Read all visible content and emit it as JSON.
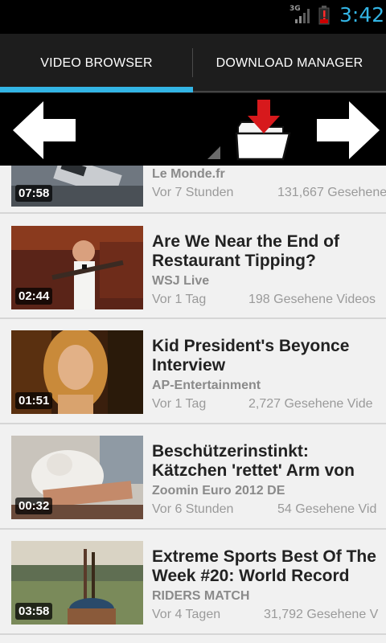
{
  "status_bar": {
    "network": "3G",
    "time": "3:42"
  },
  "tabs": [
    {
      "label": "VIDEO BROWSER",
      "selected": true
    },
    {
      "label": "DOWNLOAD MANAGER",
      "selected": false
    }
  ],
  "toolbar": {
    "back_icon": "arrow-left-icon",
    "download_icon": "download-folder-icon",
    "forward_icon": "arrow-right-icon"
  },
  "videos": [
    {
      "title_lines": [],
      "channel": "Le Monde.fr",
      "age": "Vor 7 Stunden",
      "views": "131,667 Gesehene",
      "duration": "07:58"
    },
    {
      "title_lines": [
        "Are We Near the End of",
        "Restaurant Tipping?"
      ],
      "channel": "WSJ Live",
      "age": "Vor 1 Tag",
      "views": "198 Gesehene Videos",
      "duration": "02:44"
    },
    {
      "title_lines": [
        "Kid President's Beyonce",
        "Interview"
      ],
      "channel": "AP-Entertainment",
      "age": "Vor 1 Tag",
      "views": "2,727 Gesehene Vide",
      "duration": "01:51"
    },
    {
      "title_lines": [
        "Beschützerinstinkt:",
        "Kätzchen 'rettet' Arm von"
      ],
      "channel": "Zoomin Euro 2012 DE",
      "age": "Vor 6 Stunden",
      "views": "54 Gesehene Vid",
      "duration": "00:32"
    },
    {
      "title_lines": [
        "Extreme Sports Best Of The",
        "Week #20: World Record"
      ],
      "channel": "RIDERS MATCH",
      "age": "Vor 4 Tagen",
      "views": "31,792 Gesehene V",
      "duration": "03:58"
    }
  ]
}
